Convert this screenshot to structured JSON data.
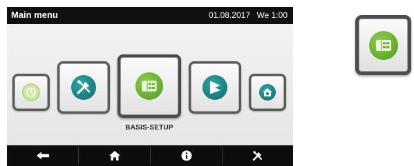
{
  "header": {
    "title": "Main menu",
    "date": "01.08.2017",
    "time": "We 1:00"
  },
  "menu": {
    "selected_label": "BASIS-SETUP",
    "tiles": [
      {
        "name": "clock-tile",
        "icon": "clock-icon"
      },
      {
        "name": "service-tile",
        "icon": "tools-icon"
      },
      {
        "name": "basis-setup-tile",
        "icon": "heat-pump-icon"
      },
      {
        "name": "flag-tile",
        "icon": "flag-icon"
      },
      {
        "name": "house-tile",
        "icon": "house-settings-icon"
      }
    ]
  },
  "footer": {
    "buttons": [
      {
        "name": "back-button",
        "icon": "arrow-left-icon"
      },
      {
        "name": "home-button",
        "icon": "home-icon"
      },
      {
        "name": "info-button",
        "icon": "info-icon"
      },
      {
        "name": "tools-button",
        "icon": "tools-icon"
      }
    ]
  },
  "colors": {
    "accent_teal": "#1e8a8c",
    "accent_green": "#6bb32e",
    "clock_green": "#cfe6a6",
    "header_bg": "#101010",
    "footer_bg": "#0d0d0d"
  }
}
